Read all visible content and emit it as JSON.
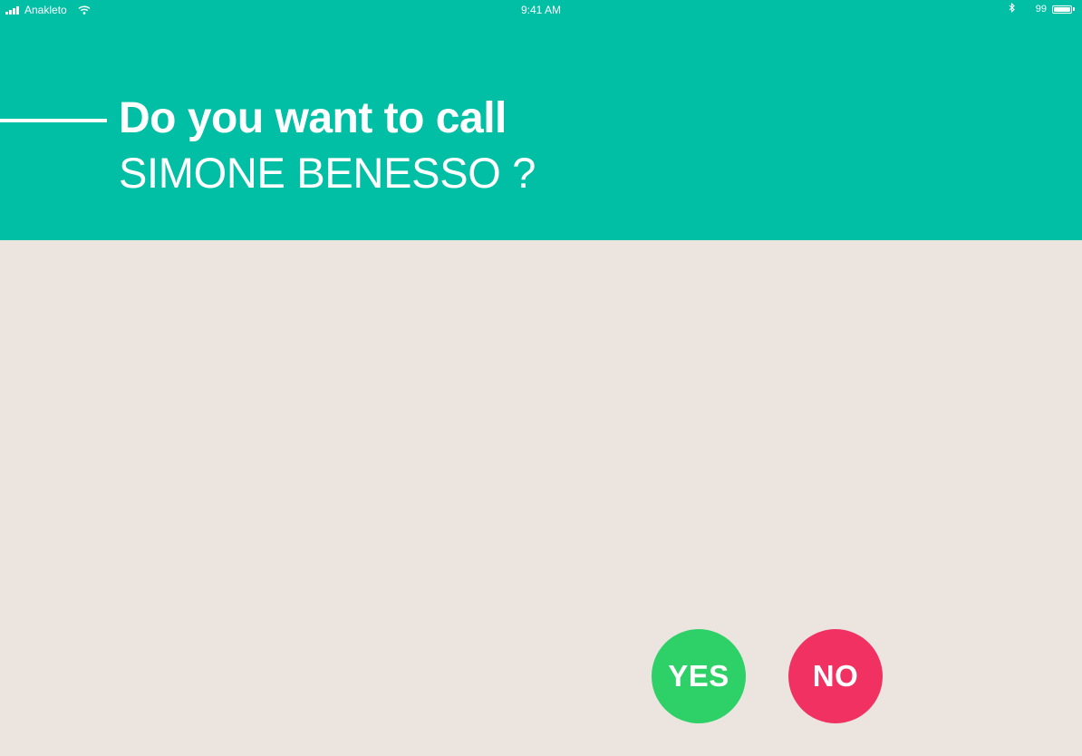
{
  "status_bar": {
    "carrier": "Anakleto",
    "time": "9:41 AM",
    "battery_percent": "99",
    "battery_level": 0.99,
    "icons": [
      "signal-icon",
      "wifi-icon",
      "bluetooth-icon",
      "battery-icon"
    ]
  },
  "dialog": {
    "prompt": "Do you want to call",
    "contact_name": "SIMONE BENESSO ?",
    "yes_label": "YES",
    "no_label": "NO"
  },
  "colors": {
    "header_teal": "#00bfa5",
    "background": "#ece5df",
    "yes_green": "#2ed068",
    "no_red": "#f03162",
    "text_white": "#ffffff"
  }
}
